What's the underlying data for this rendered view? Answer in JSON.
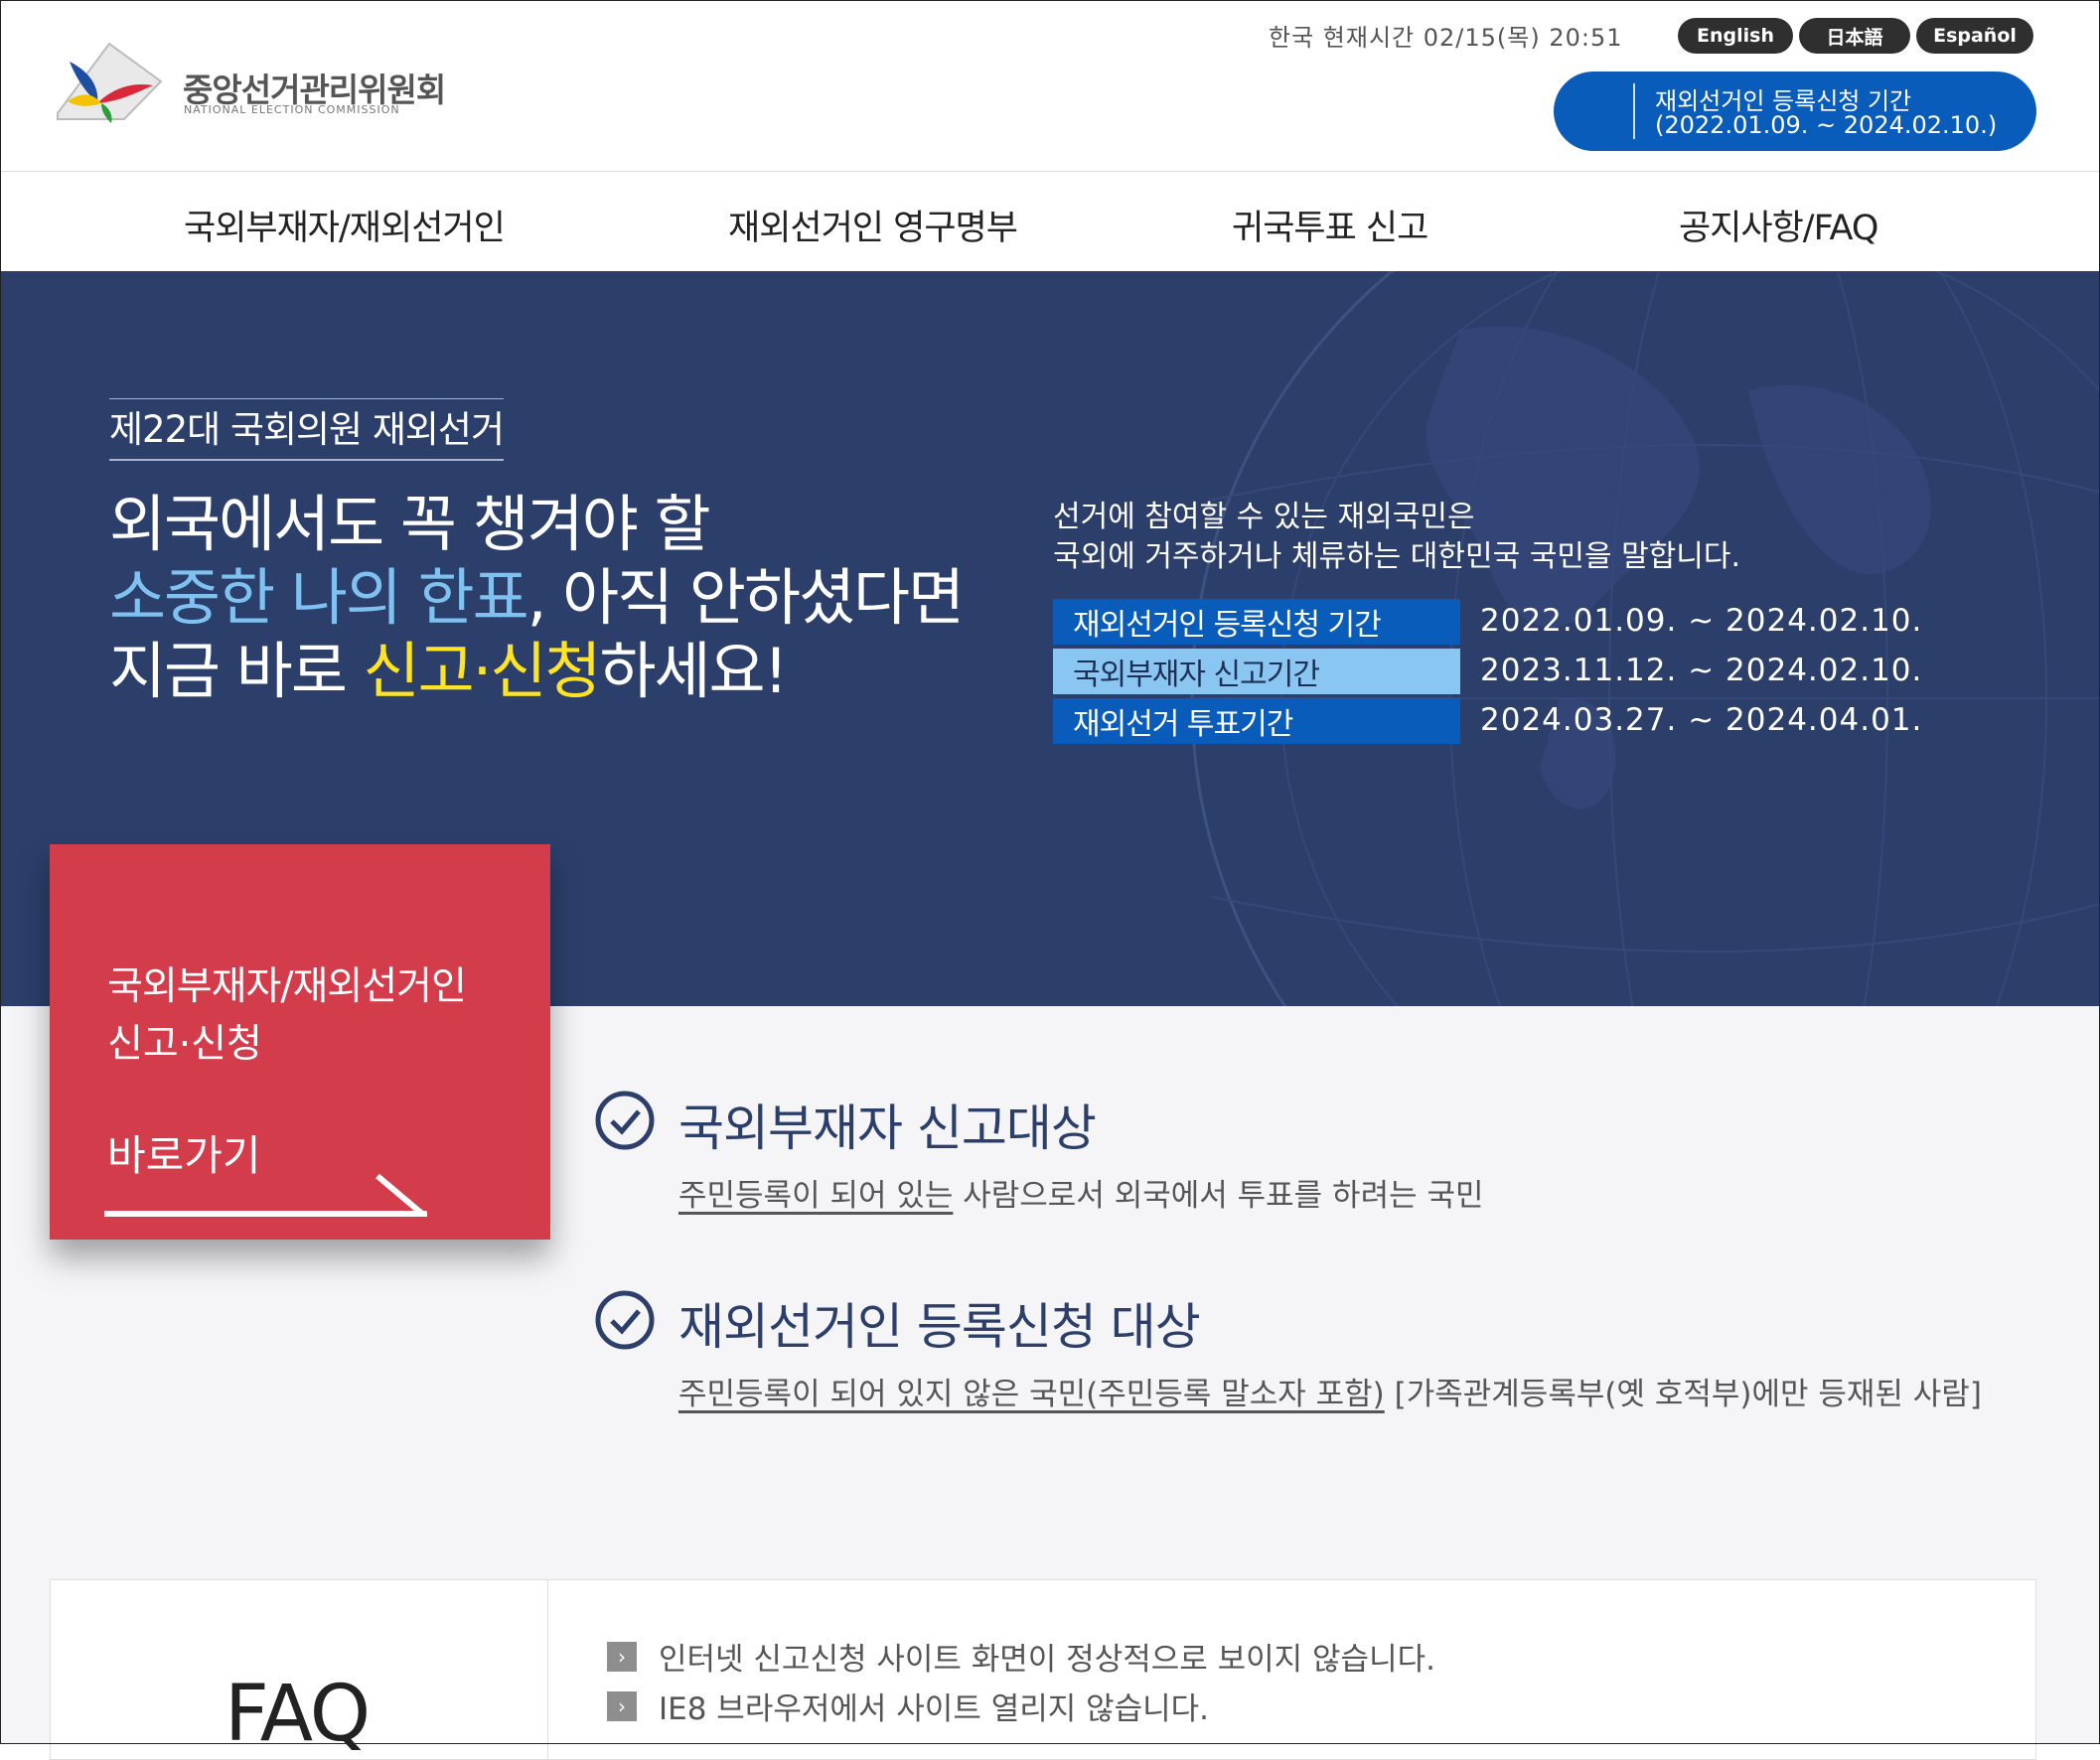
{
  "header": {
    "logo_name": "중앙선거관리위원회",
    "logo_sub": "NATIONAL ELECTION COMMISSION",
    "clock": "한국 현재시간 02/15(목) 20:51",
    "languages": [
      "English",
      "日本語",
      "Español"
    ],
    "registration_pill": {
      "line1": "재외선거인 등록신청 기간",
      "line2": "(2022.01.09. ~ 2024.02.10.)"
    }
  },
  "nav": {
    "items": [
      "국외부재자/재외선거인",
      "재외선거인 영구명부",
      "귀국투표 신고",
      "공지사항/FAQ"
    ]
  },
  "hero": {
    "kicker": "제22대 국회의원 재외선거",
    "headline": {
      "line1": "외국에서도 꼭 챙겨야 할",
      "line2_highlight": "소중한 나의 한표",
      "line2_rest": ", 아직 안하셨다면",
      "line3_pre": "지금 바로 ",
      "line3_highlight": "신고·신청",
      "line3_post": "하세요!"
    },
    "intro": {
      "line1": "선거에 참여할 수 있는 재외국민은",
      "line2": "국외에 거주하거나 체류하는 대한민국 국민을 말합니다."
    },
    "periods": [
      {
        "label": "재외선거인 등록신청 기간",
        "dates": "2022.01.09. ~ 2024.02.10.",
        "color": "#0a5cba"
      },
      {
        "label": "국외부재자 신고기간",
        "dates": "2023.11.12. ~ 2024.02.10.",
        "color": "#8ac6f2"
      },
      {
        "label": "재외선거 투표기간",
        "dates": "2024.03.27. ~ 2024.04.01.",
        "color": "#0a5cba"
      }
    ]
  },
  "cta_card": {
    "line1": "국외부재자/재외선거인",
    "line2": "신고·신청",
    "go_label": "바로가기"
  },
  "targets": [
    {
      "title": "국외부재자 신고대상",
      "desc_underlined": "주민등록이 되어 있는",
      "desc_rest": " 사람으로서 외국에서 투표를 하려는 국민"
    },
    {
      "title": "재외선거인 등록신청 대상",
      "desc_underlined": "주민등록이 되어 있지 않은 국민(주민등록 말소자 포함)",
      "desc_rest": " [가족관계등록부(옛 호적부)에만 등재된 사람]"
    }
  ],
  "faq": {
    "title": "FAQ",
    "items": [
      "인터넷 신고신청 사이트 화면이 정상적으로 보이지 않습니다.",
      "IE8 브라우저에서 사이트 열리지 않습니다."
    ]
  },
  "colors": {
    "hero_bg": "#2c3f6b",
    "accent_blue": "#0a5cba",
    "light_blue": "#8ac6f2",
    "highlight_blue": "#7fc1f0",
    "highlight_yellow": "#ffe426",
    "cta_red": "#d33c4b"
  }
}
